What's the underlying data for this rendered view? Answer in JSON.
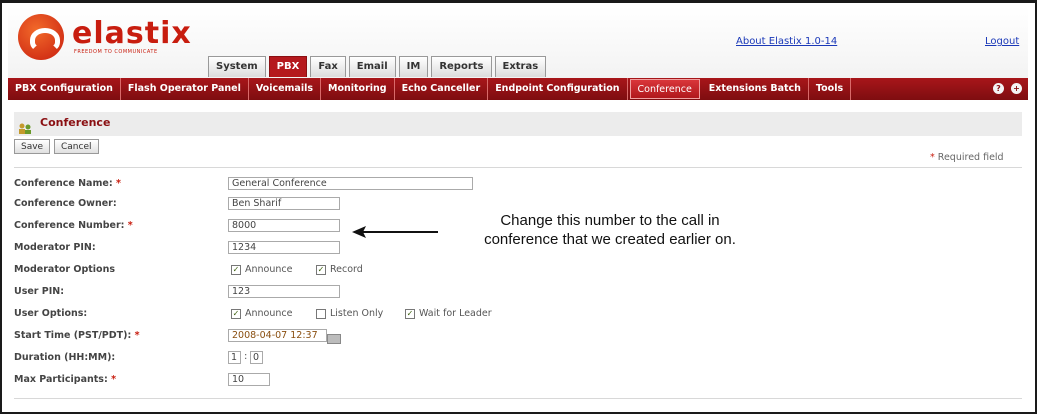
{
  "brand": {
    "name": "elastix",
    "tagline": "FREEDOM TO COMMUNICATE",
    "about": "About Elastix 1.0-14",
    "logout": "Logout"
  },
  "top_tabs": [
    "System",
    "PBX",
    "Fax",
    "Email",
    "IM",
    "Reports",
    "Extras"
  ],
  "active_top_tab": "PBX",
  "menu": [
    "PBX Configuration",
    "Flash Operator Panel",
    "Voicemails",
    "Monitoring",
    "Echo Canceller",
    "Endpoint Configuration",
    "Conference",
    "Extensions Batch",
    "Tools"
  ],
  "active_menu": "Conference",
  "page": {
    "title": "Conference",
    "save": "Save",
    "cancel": "Cancel",
    "required_star": "*",
    "required_text": "Required field"
  },
  "form": {
    "conference_name": {
      "label": "Conference Name:",
      "value": "General Conference"
    },
    "conference_owner": {
      "label": "Conference Owner:",
      "value": "Ben Sharif"
    },
    "conference_number": {
      "label": "Conference Number:",
      "value": "8000"
    },
    "moderator_pin": {
      "label": "Moderator PIN:",
      "value": "1234"
    },
    "moderator_options": {
      "label": "Moderator Options",
      "announce": "Announce",
      "record": "Record"
    },
    "user_pin": {
      "label": "User PIN:",
      "value": "123"
    },
    "user_options": {
      "label": "User Options:",
      "announce": "Announce",
      "listen_only": "Listen Only",
      "wait_for_leader": "Wait for Leader"
    },
    "start_time": {
      "label": "Start Time (PST/PDT):",
      "value": "2008-04-07 12:37"
    },
    "duration": {
      "label": "Duration (HH:MM):",
      "hours": "1",
      "sep": ":",
      "minutes": "0"
    },
    "max_participants": {
      "label": "Max Participants:",
      "value": "10"
    },
    "star": "*"
  },
  "annotation": {
    "line1": "Change this number to the call in",
    "line2": "conference that we created earlier on."
  },
  "colors": {
    "brand_red": "#c81d0f",
    "menu_red": "#a8161a",
    "link_blue": "#1a38b8"
  }
}
